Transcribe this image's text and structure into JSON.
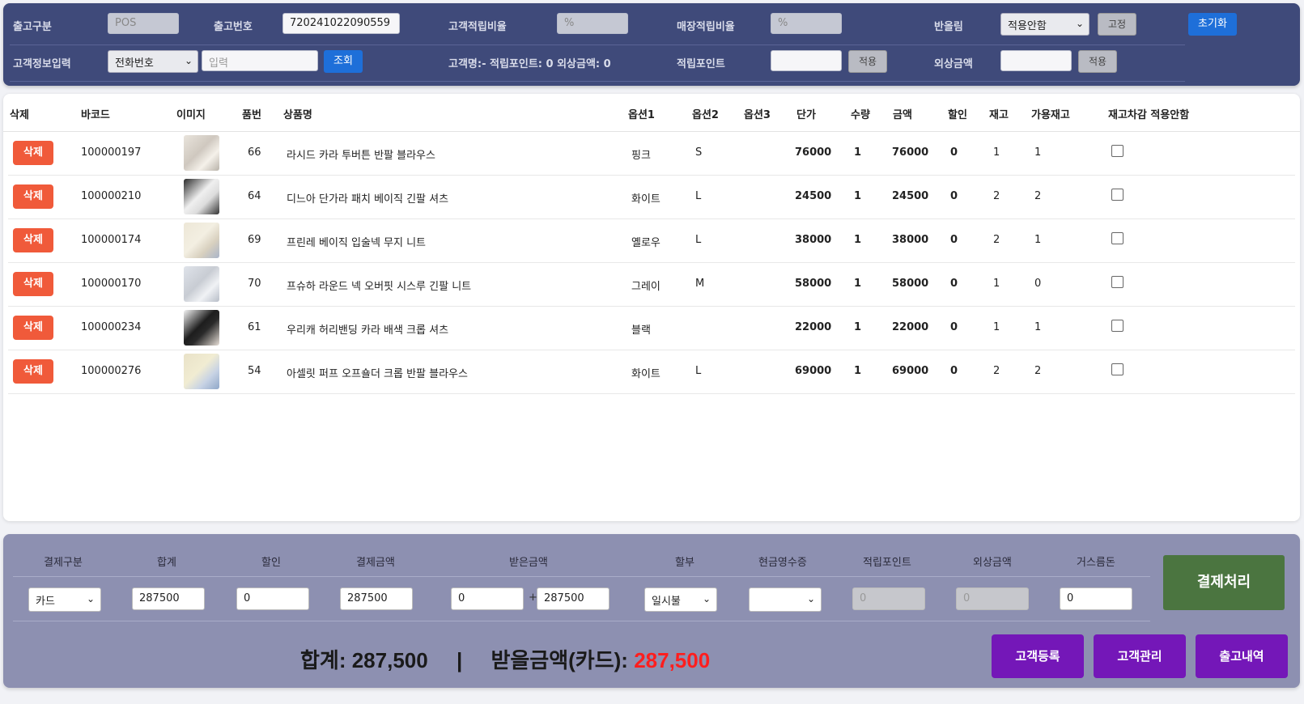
{
  "top": {
    "release_type_label": "출고구분",
    "release_type_value": "POS",
    "release_no_label": "출고번호",
    "release_no_value": "720241022090559",
    "cust_rate_label": "고객적립비율",
    "cust_rate_placeholder": "%",
    "store_rate_label": "매장적립비율",
    "store_rate_placeholder": "%",
    "rounding_label": "반올림",
    "rounding_value": "적용안함",
    "fix_button": "고정",
    "reset_button": "초기화",
    "cust_info_label": "고객정보입력",
    "cust_info_select": "전화번호",
    "cust_info_placeholder": "입력",
    "search_button": "조회",
    "cust_summary": "고객명:- 적립포인트: 0 외상금액: 0",
    "points_label": "적립포인트",
    "points_apply": "적용",
    "credit_label": "외상금액",
    "credit_apply": "적용"
  },
  "table": {
    "headers": [
      "삭제",
      "바코드",
      "이미지",
      "품번",
      "상품명",
      "옵션1",
      "옵션2",
      "옵션3",
      "단가",
      "수량",
      "금액",
      "할인",
      "재고",
      "가용재고",
      "재고차감 적용안함"
    ],
    "delete_label": "삭제",
    "rows": [
      {
        "barcode": "100000197",
        "no": "66",
        "name": "라시드 카라 투버튼 반팔 블라우스",
        "opt1": "핑크",
        "opt2": "S",
        "opt3": "",
        "price": "76000",
        "qty": "1",
        "amount": "76000",
        "discount": "0",
        "stock": "1",
        "avail": "1"
      },
      {
        "barcode": "100000210",
        "no": "64",
        "name": "디느아 단가라 패치 베이직 긴팔 셔츠",
        "opt1": "화이트",
        "opt2": "L",
        "opt3": "",
        "price": "24500",
        "qty": "1",
        "amount": "24500",
        "discount": "0",
        "stock": "2",
        "avail": "2"
      },
      {
        "barcode": "100000174",
        "no": "69",
        "name": "프린레 베이직 입술넥 무지 니트",
        "opt1": "옐로우",
        "opt2": "L",
        "opt3": "",
        "price": "38000",
        "qty": "1",
        "amount": "38000",
        "discount": "0",
        "stock": "2",
        "avail": "1"
      },
      {
        "barcode": "100000170",
        "no": "70",
        "name": "프슈하 라운드 넥 오버핏 시스루 긴팔 니트",
        "opt1": "그레이",
        "opt2": "M",
        "opt3": "",
        "price": "58000",
        "qty": "1",
        "amount": "58000",
        "discount": "0",
        "stock": "1",
        "avail": "0"
      },
      {
        "barcode": "100000234",
        "no": "61",
        "name": "우리캐 허리밴딩 카라 배색 크롭 셔츠",
        "opt1": "블랙",
        "opt2": "",
        "opt3": "",
        "price": "22000",
        "qty": "1",
        "amount": "22000",
        "discount": "0",
        "stock": "1",
        "avail": "1"
      },
      {
        "barcode": "100000276",
        "no": "54",
        "name": "아셀릿 퍼프 오프숄더 크롭 반팔 블라우스",
        "opt1": "화이트",
        "opt2": "L",
        "opt3": "",
        "price": "69000",
        "qty": "1",
        "amount": "69000",
        "discount": "0",
        "stock": "2",
        "avail": "2"
      }
    ]
  },
  "bottom": {
    "headers": [
      "결제구분",
      "합계",
      "할인",
      "결제금액",
      "받은금액",
      "할부",
      "현금영수증",
      "적립포인트",
      "외상금액",
      "거스름돈"
    ],
    "pay_type": "카드",
    "total": "287500",
    "discount": "0",
    "pay_amount": "287500",
    "received_a": "0",
    "plus": "+",
    "received_b": "287500",
    "installment": "일시불",
    "cash_receipt": "",
    "points": "0",
    "credit": "0",
    "change": "0",
    "pay_button": "결제처리",
    "summary_total": "합계: 287,500",
    "summary_sep": "|",
    "summary_recv_label": "받을금액(카드): ",
    "summary_recv_value": "287,500",
    "btn_register": "고객등록",
    "btn_manage": "고객관리",
    "btn_history": "출고내역"
  },
  "colors": {
    "top_panel": "#3f4a7a",
    "accent_blue": "#1e6fd9",
    "delete_red": "#f05a3a",
    "pay_green": "#4b7540",
    "purple_button": "#7417b8",
    "bottom_panel": "#8d90b1",
    "highlight_red": "#ff1e1e"
  }
}
